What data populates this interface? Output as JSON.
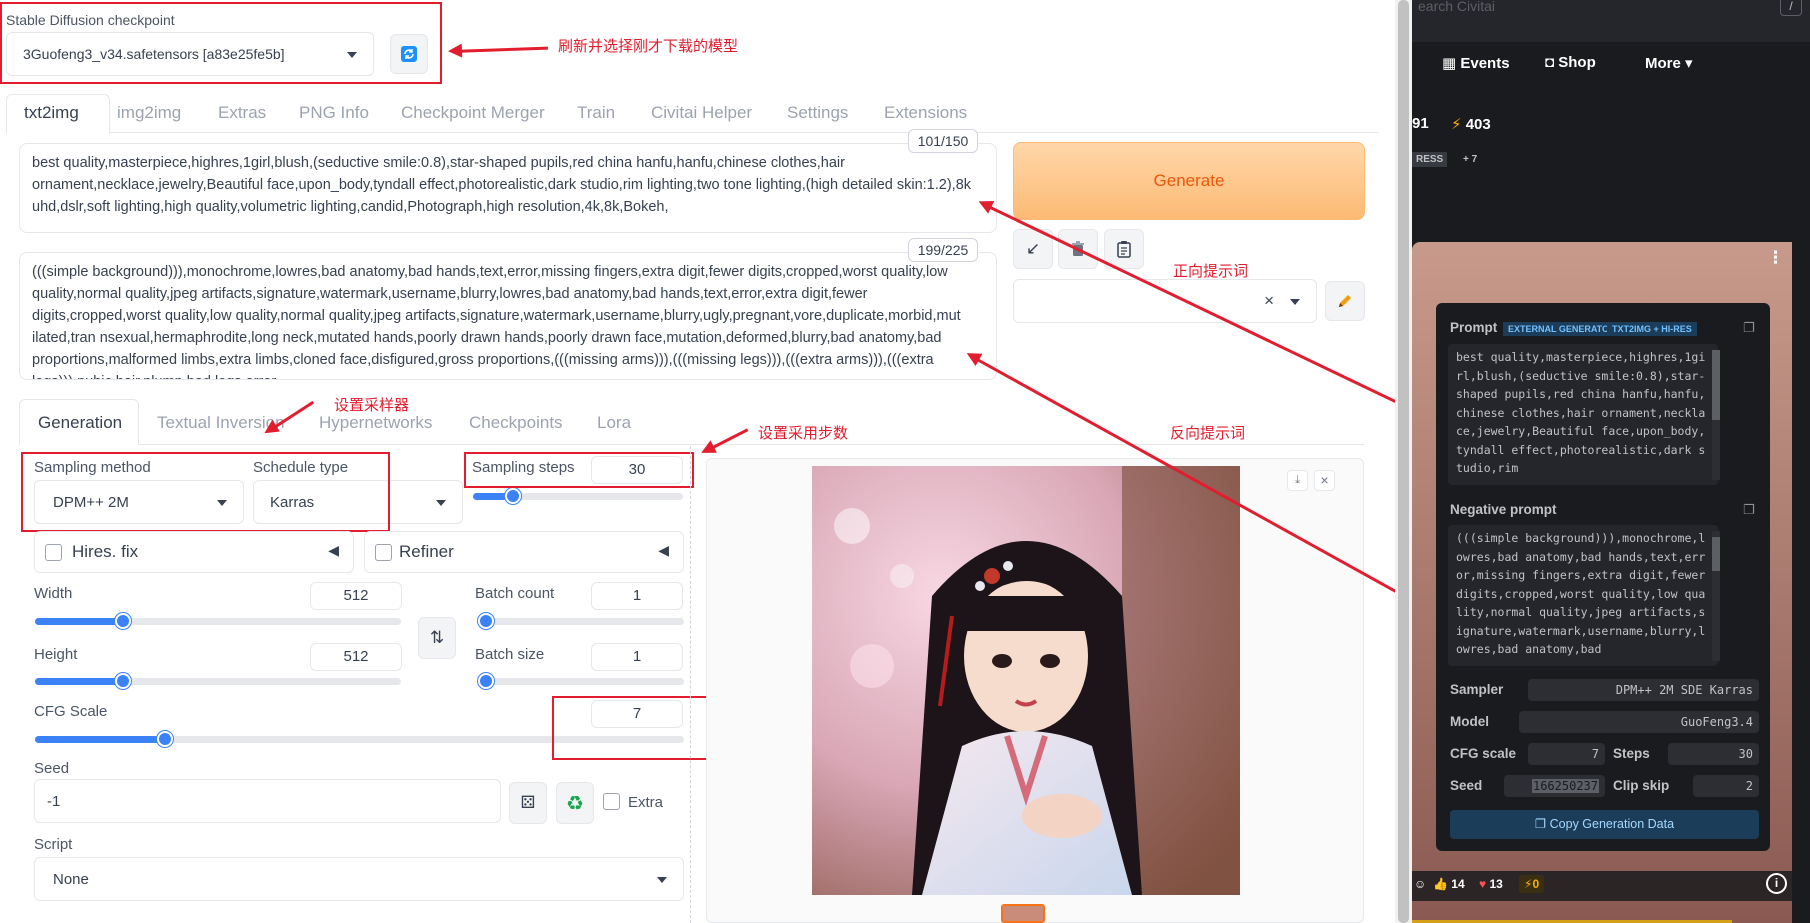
{
  "checkpoint": {
    "label": "Stable Diffusion checkpoint",
    "value": "3Guofeng3_v34.safetensors [a83e25fe5b]"
  },
  "tabs": [
    "txt2img",
    "img2img",
    "Extras",
    "PNG Info",
    "Checkpoint Merger",
    "Train",
    "Civitai Helper",
    "Settings",
    "Extensions"
  ],
  "prompt": {
    "counter": "101/150",
    "text": "best quality,masterpiece,highres,1girl,blush,(seductive smile:0.8),star-shaped pupils,red china hanfu,hanfu,chinese clothes,hair ornament,necklace,jewelry,Beautiful face,upon_body,tyndall effect,photorealistic,dark studio,rim lighting,two tone lighting,(high detailed skin:1.2),8k uhd,dslr,soft lighting,high quality,volumetric lighting,candid,Photograph,high resolution,4k,8k,Bokeh,"
  },
  "negative": {
    "counter": "199/225",
    "text": "(((simple background))),monochrome,lowres,bad anatomy,bad hands,text,error,missing fingers,extra digit,fewer digits,cropped,worst quality,low quality,normal quality,jpeg artifacts,signature,watermark,username,blurry,lowres,bad anatomy,bad hands,text,error,extra digit,fewer digits,cropped,worst quality,low quality,normal quality,jpeg artifacts,signature,watermark,username,blurry,ugly,pregnant,vore,duplicate,morbid,mut ilated,tran nsexual,hermaphrodite,long neck,mutated hands,poorly drawn hands,poorly drawn face,mutation,deformed,blurry,bad anatomy,bad proportions,malformed limbs,extra limbs,cloned face,disfigured,gross proportions,(((missing arms))),(((missing legs))),(((extra arms))),(((extra legs))),pubic hair,plump,bad legs,error"
  },
  "generate_label": "Generate",
  "subtabs": [
    "Generation",
    "Textual Inversion",
    "Hypernetworks",
    "Checkpoints",
    "Lora"
  ],
  "sampling": {
    "method_label": "Sampling method",
    "method": "DPM++ 2M",
    "schedule_label": "Schedule type",
    "schedule": "Karras",
    "steps_label": "Sampling steps",
    "steps": "30",
    "steps_fraction": 0.19
  },
  "hires_label": "Hires. fix",
  "refiner_label": "Refiner",
  "width": {
    "label": "Width",
    "value": "512",
    "fraction": 0.24
  },
  "height": {
    "label": "Height",
    "value": "512",
    "fraction": 0.24
  },
  "batch_count": {
    "label": "Batch count",
    "value": "1",
    "fraction": 0
  },
  "batch_size": {
    "label": "Batch size",
    "value": "1",
    "fraction": 0
  },
  "cfg": {
    "label": "CFG Scale",
    "value": "7",
    "fraction": 0.2
  },
  "seed": {
    "label": "Seed",
    "value": "-1",
    "extra_label": "Extra"
  },
  "script": {
    "label": "Script",
    "value": "None"
  },
  "annotations": {
    "refresh": "刷新并选择刚才下载的模型",
    "positive": "正向提示词",
    "sampler": "设置采样器",
    "steps": "设置采用步数",
    "negative": "反向提示词"
  },
  "civitai": {
    "search_placeholder": "earch Civitai",
    "slash": "/",
    "nav": [
      "Events",
      "Shop",
      "More"
    ],
    "stats": {
      "left": "91",
      "bolt": "403"
    },
    "badges": [
      "RESS",
      "+ 7"
    ],
    "prompt_label": "Prompt",
    "tag1": "EXTERNAL GENERATOR",
    "tag2": "TXT2IMG + HI-RES",
    "prompt_text": "best quality,masterpiece,highres,1girl,blush,(seductive smile:0.8),star-shaped pupils,red china hanfu,hanfu,chinese clothes,hair ornament,necklace,jewelry,Beautiful face,upon_body,tyndall effect,photorealistic,dark studio,rim",
    "neg_label": "Negative prompt",
    "neg_text": "(((simple background))),monochrome,lowres,bad anatomy,bad hands,text,error,missing fingers,extra digit,fewer digits,cropped,worst quality,low quality,normal quality,jpeg artifacts,signature,watermark,username,blurry,lowres,bad anatomy,bad",
    "sampler_label": "Sampler",
    "sampler": "DPM++ 2M SDE Karras",
    "model_label": "Model",
    "model": "GuoFeng3.4",
    "cfg_label": "CFG scale",
    "cfg": "7",
    "steps_label": "Steps",
    "steps": "30",
    "seed_label": "Seed",
    "seed": "166250237",
    "clip_label": "Clip skip",
    "clip": "2",
    "copy_label": "Copy Generation Data",
    "reactions": {
      "like": "14",
      "heart": "13",
      "bolt": "0"
    }
  }
}
